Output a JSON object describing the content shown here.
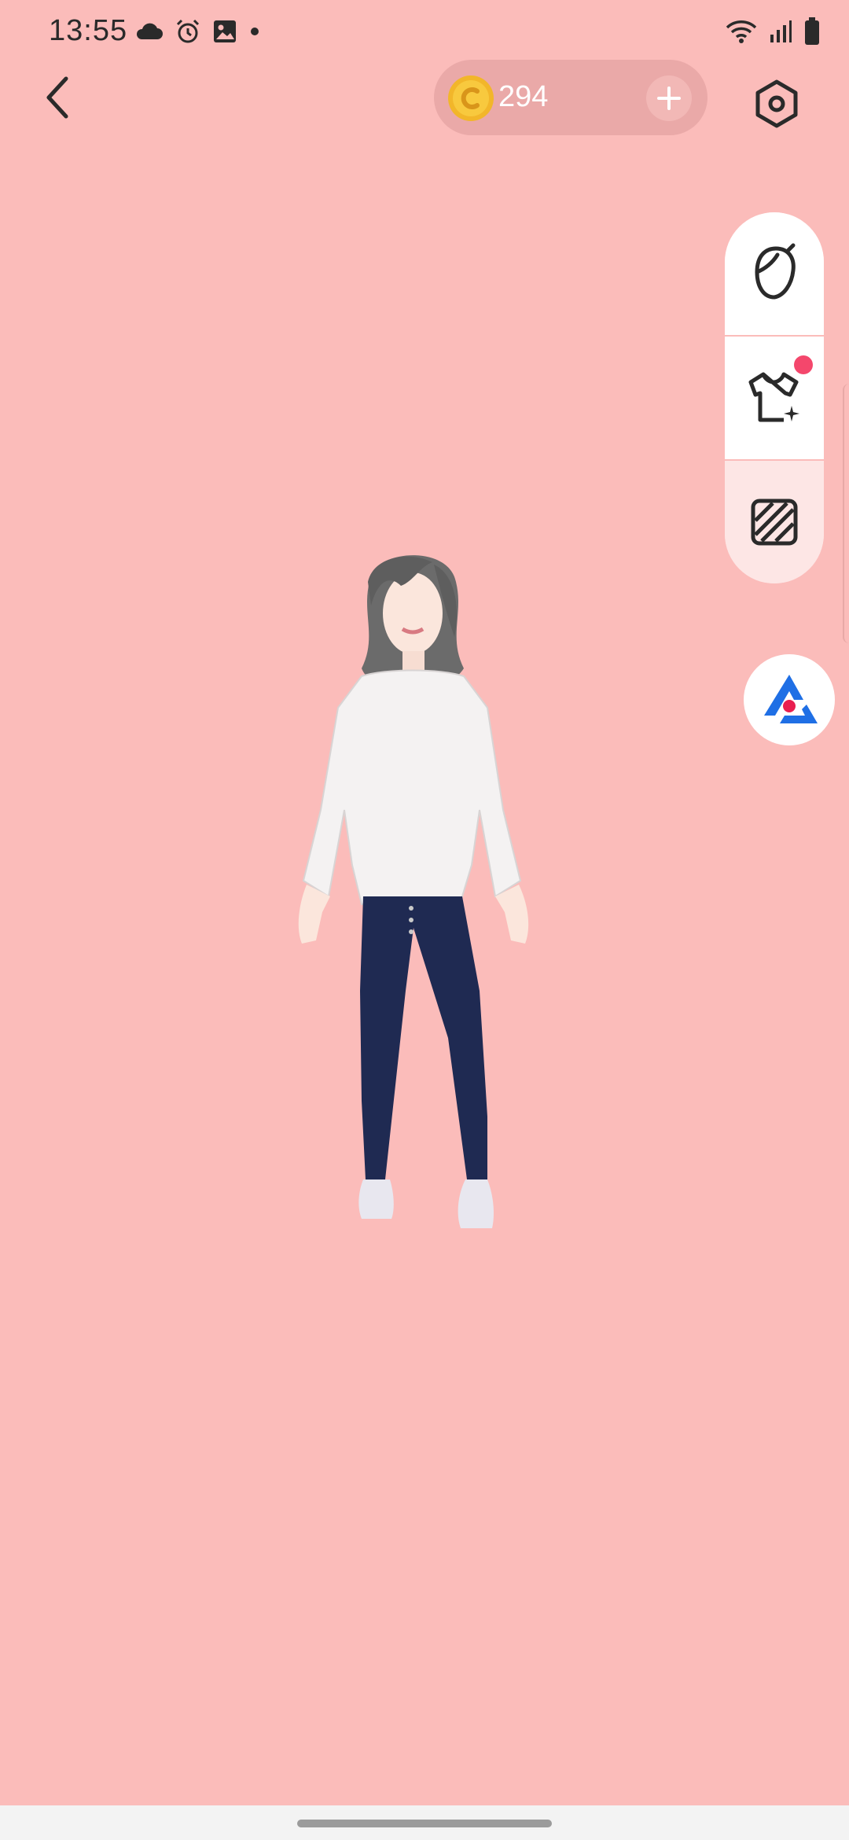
{
  "status_bar": {
    "time": "13:55",
    "left_icons": [
      "cloud-icon",
      "alarm-icon",
      "image-icon",
      "dot-icon"
    ],
    "right_icons": [
      "wifi-icon",
      "signal-icon",
      "battery-icon"
    ]
  },
  "top_bar": {
    "back_icon": "chevron-left-icon",
    "coins": {
      "amount": "294",
      "icon": "coin-icon",
      "add_icon": "plus-icon"
    },
    "settings_icon": "hexagon-settings-icon"
  },
  "side_toolbar": {
    "items": [
      {
        "name": "face",
        "icon": "face-icon"
      },
      {
        "name": "outfit",
        "icon": "tshirt-sparkle-icon",
        "has_notification": true
      },
      {
        "name": "background",
        "icon": "striped-square-icon"
      }
    ]
  },
  "ar_button": {
    "icon": "ar-camera-logo-icon"
  },
  "colors": {
    "background": "#fbbcba",
    "pill": "#eaa9a8",
    "notification": "#f4476c",
    "ar_blue": "#1f6fe5"
  }
}
